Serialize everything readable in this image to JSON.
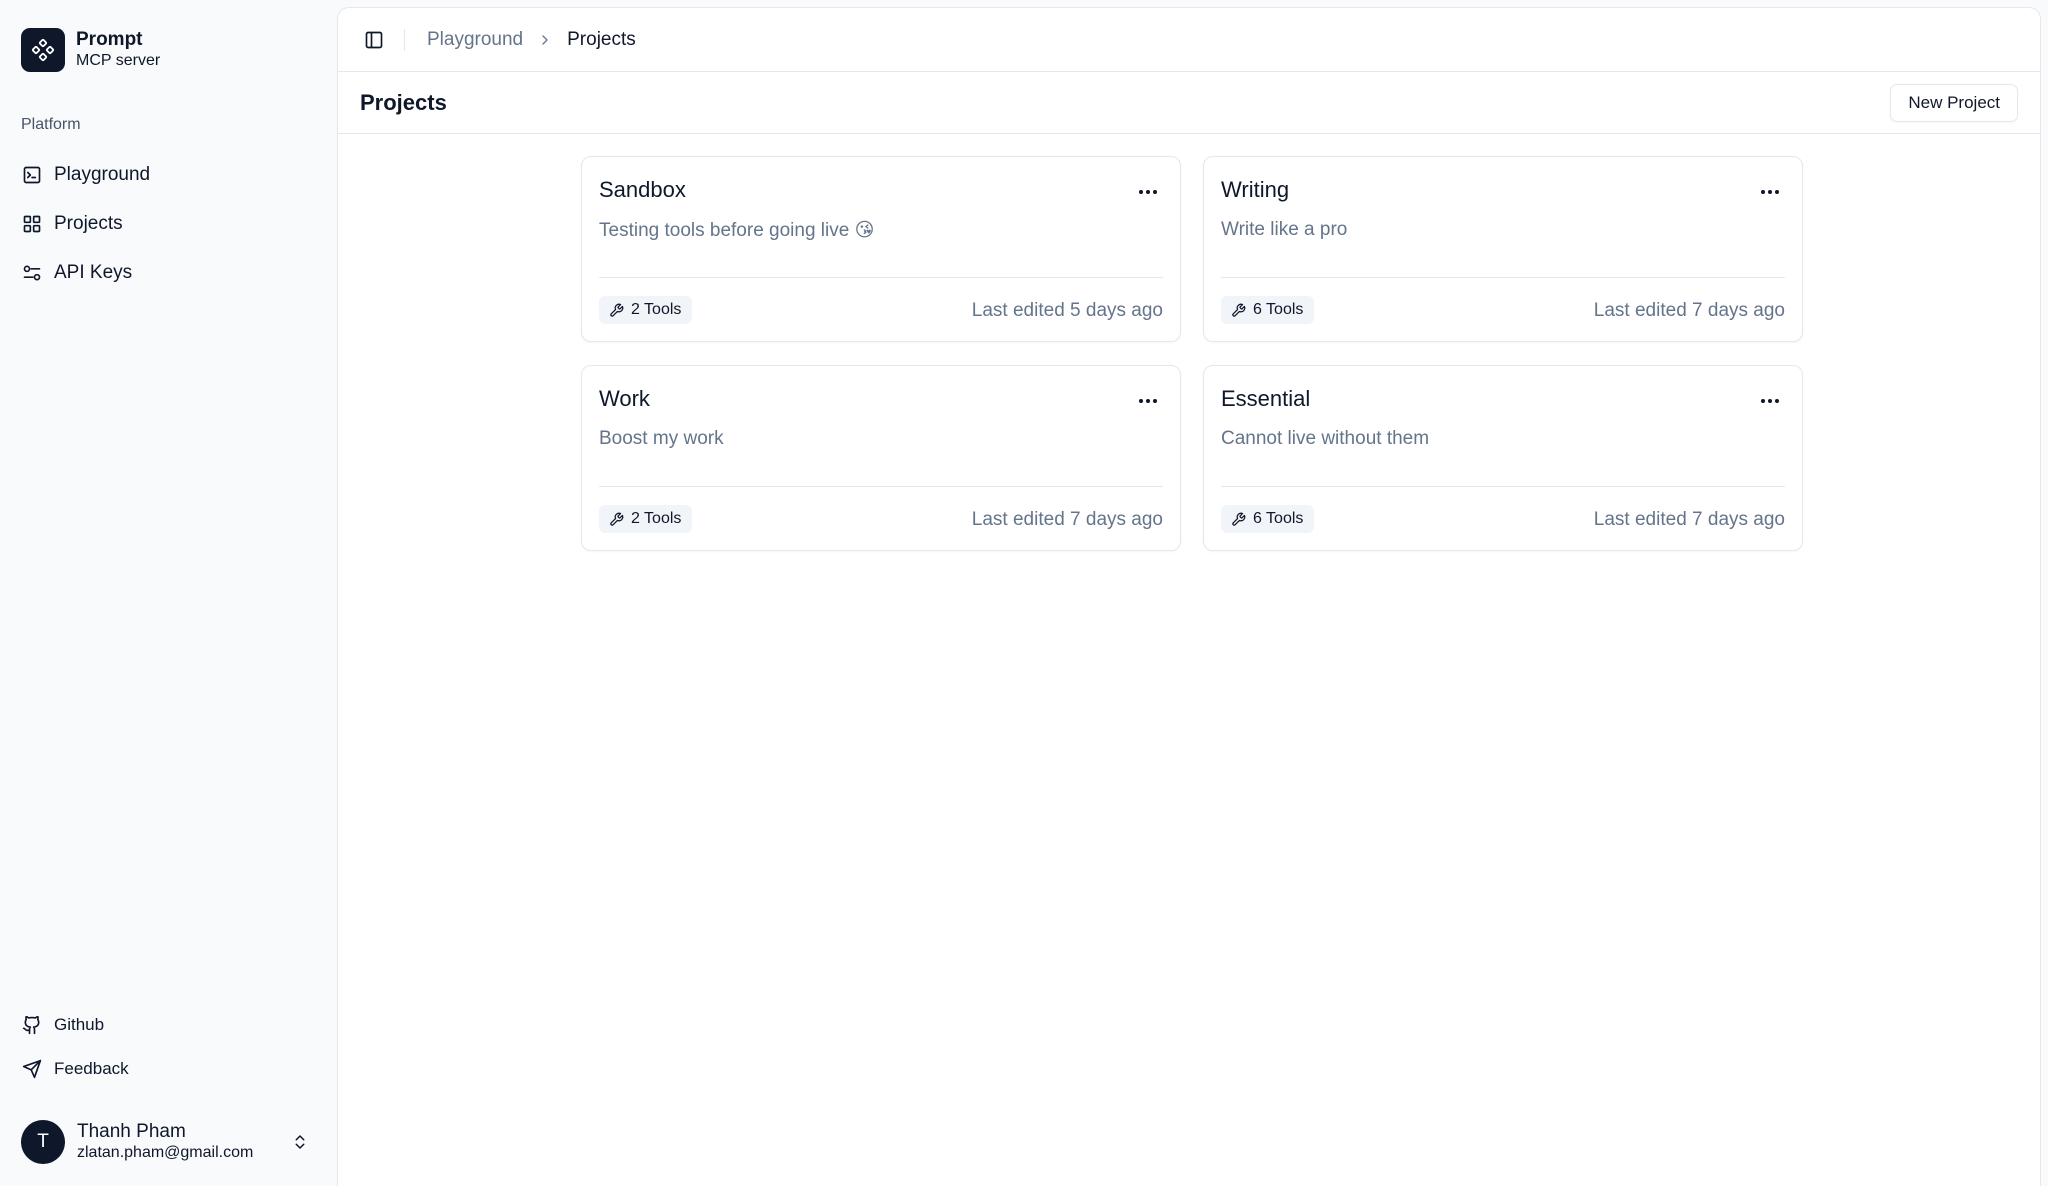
{
  "app": {
    "name": "Prompt",
    "subtitle": "MCP server"
  },
  "sidebar": {
    "section_label": "Platform",
    "items": [
      {
        "label": "Playground",
        "icon": "terminal-square-icon"
      },
      {
        "label": "Projects",
        "icon": "grid-icon"
      },
      {
        "label": "API Keys",
        "icon": "settings-sliders-icon"
      }
    ],
    "footer": [
      {
        "label": "Github",
        "icon": "github-icon"
      },
      {
        "label": "Feedback",
        "icon": "send-icon"
      }
    ],
    "user": {
      "initial": "T",
      "name": "Thanh Pham",
      "email": "zlatan.pham@gmail.com"
    }
  },
  "breadcrumb": {
    "parent": "Playground",
    "current": "Projects"
  },
  "page": {
    "title": "Projects",
    "new_button": "New Project"
  },
  "projects": [
    {
      "title": "Sandbox",
      "description": "Testing tools before going live 😘",
      "tools": "2 Tools",
      "edited": "Last edited 5 days ago"
    },
    {
      "title": "Writing",
      "description": "Write like a pro",
      "tools": "6 Tools",
      "edited": "Last edited 7 days ago"
    },
    {
      "title": "Work",
      "description": "Boost my work",
      "tools": "2 Tools",
      "edited": "Last edited 7 days ago"
    },
    {
      "title": "Essential",
      "description": "Cannot live without them",
      "tools": "6 Tools",
      "edited": "Last edited 7 days ago"
    }
  ],
  "colors": {
    "primary": "#0f172a",
    "muted": "#64748b",
    "border": "#e2e8f0",
    "sidebar_bg": "#f8fafc"
  }
}
